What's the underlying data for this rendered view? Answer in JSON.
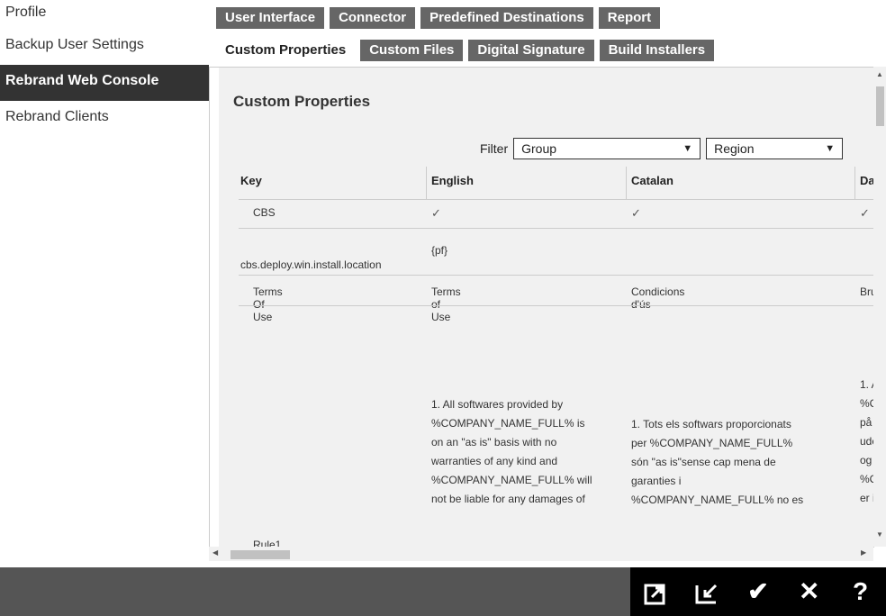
{
  "sidebar": {
    "items": [
      {
        "label": "Profile"
      },
      {
        "label": "Backup User Settings"
      },
      {
        "label": "Rebrand Web Console"
      },
      {
        "label": "Rebrand Clients"
      }
    ]
  },
  "tabs_row1": [
    {
      "label": "User Interface"
    },
    {
      "label": "Connector"
    },
    {
      "label": "Predefined Destinations"
    },
    {
      "label": "Report"
    }
  ],
  "tabs_row2": [
    {
      "label": "Custom Properties"
    },
    {
      "label": "Custom Files"
    },
    {
      "label": "Digital Signature"
    },
    {
      "label": "Build Installers"
    }
  ],
  "panel": {
    "title": "Custom Properties",
    "filter_label": "Filter",
    "group_select": "Group",
    "region_select": "Region"
  },
  "table": {
    "headers": [
      "Key",
      "English",
      "Catalan",
      "Da"
    ],
    "rows": [
      {
        "key": "CBS",
        "english": "✓",
        "catalan": "✓",
        "danish": "✓"
      },
      {
        "key": "cbs.deploy.win.install.location",
        "english": "{pf}",
        "catalan": "",
        "danish": ""
      },
      {
        "key": "Terms Of Use",
        "english": "Terms of Use",
        "catalan": "Condicions d'ús",
        "danish": "Bru"
      },
      {
        "key": "Rule1",
        "english": "1. All softwares provided by\n%COMPANY_NAME_FULL% is\non an \"as is\" basis with no\nwarranties of any kind and\n%COMPANY_NAME_FULL% will\nnot be liable for any damages of",
        "catalan": "1. Tots els softwars proporcionats\nper %COMPANY_NAME_FULL%\nsón \"as is\"sense cap mena de\ngaranties i\n%COMPANY_NAME_FULL% no es",
        "danish": "1. A\n%C\npå\nude\nog\n%C\ner i"
      }
    ]
  },
  "actions": [
    {
      "icon": "export-icon"
    },
    {
      "icon": "import-icon"
    },
    {
      "icon": "check-icon"
    },
    {
      "icon": "close-icon"
    },
    {
      "icon": "help-icon"
    }
  ]
}
